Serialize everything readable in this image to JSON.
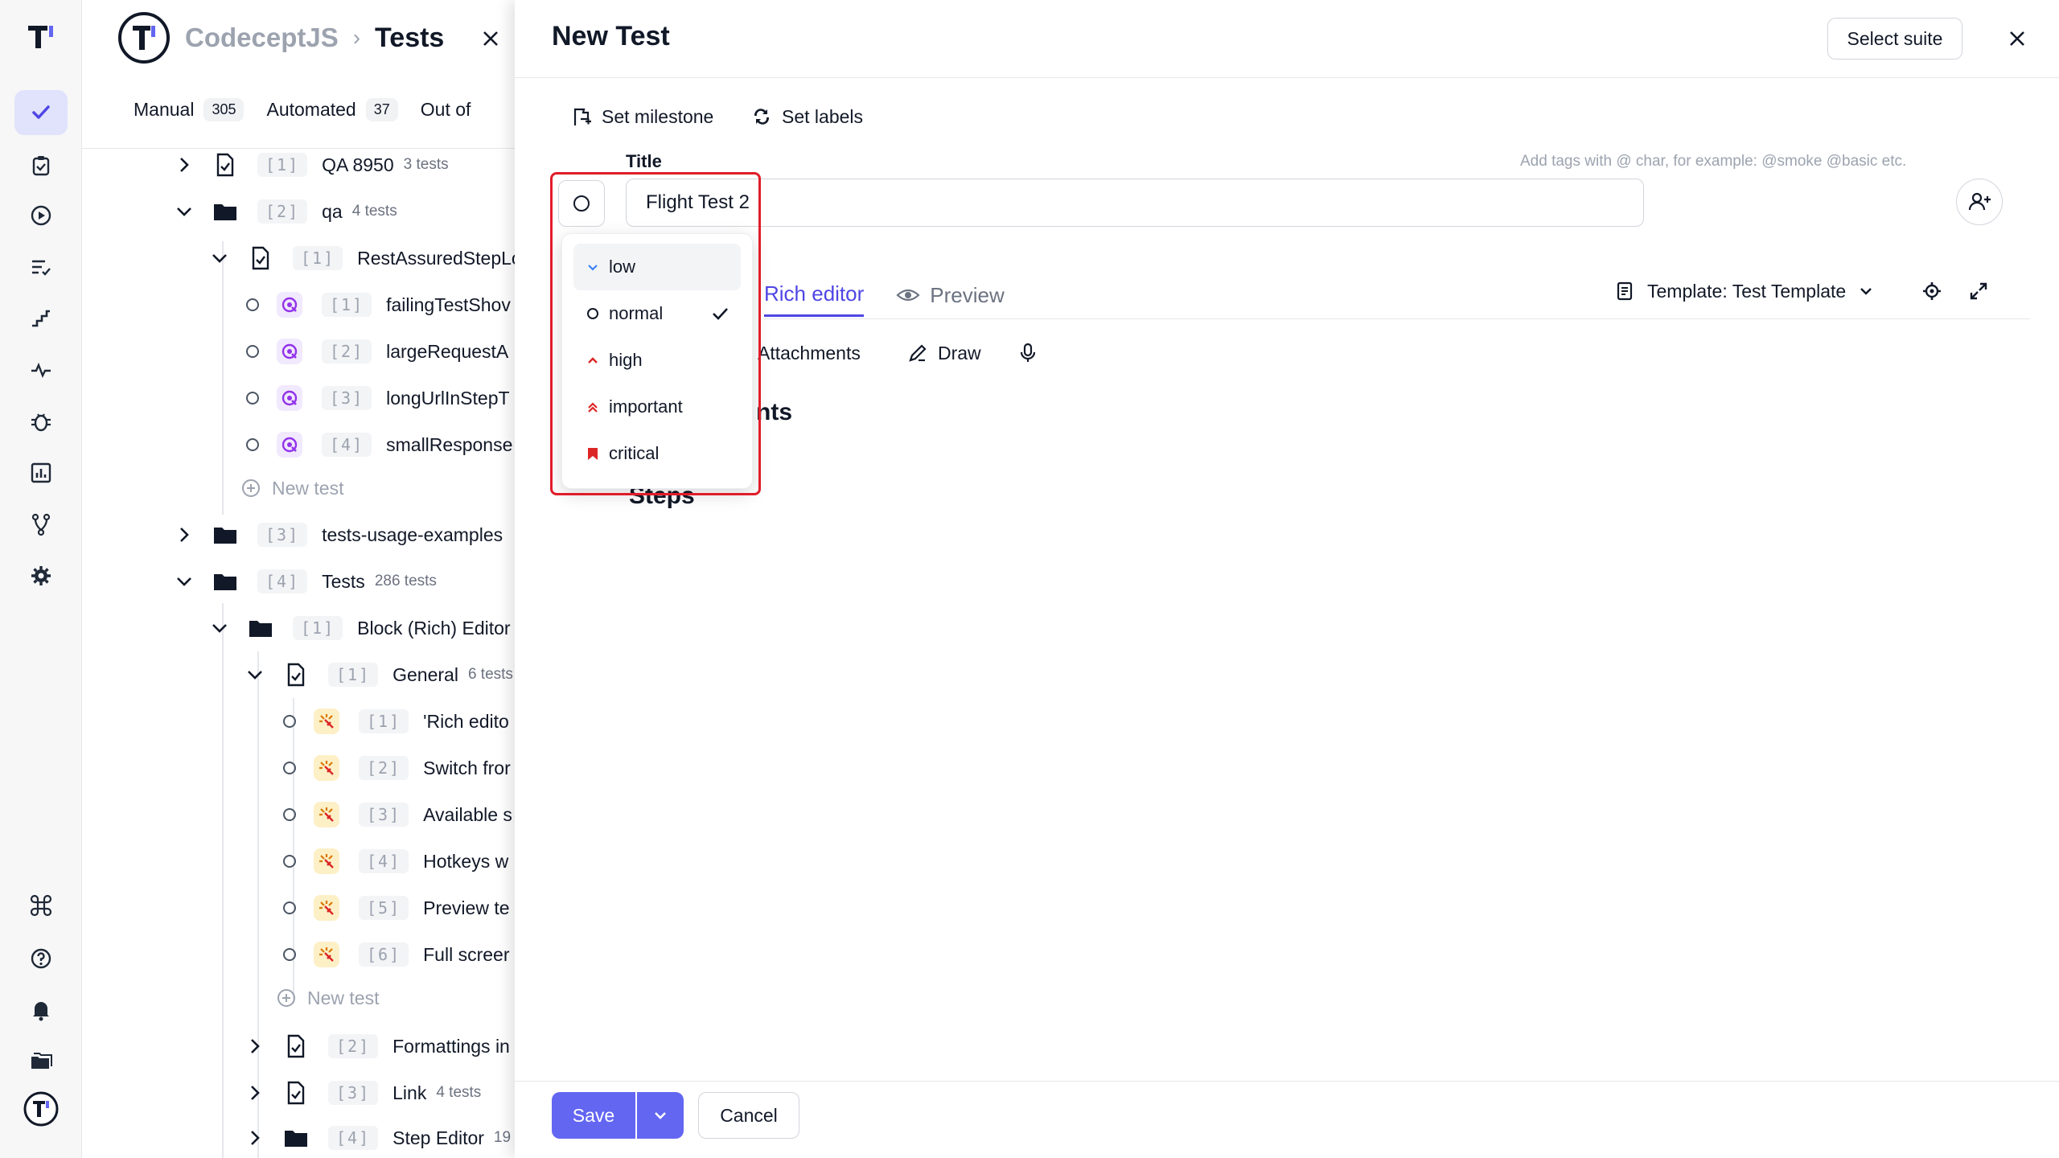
{
  "breadcrumb": {
    "project": "CodeceptJS",
    "separator": "›",
    "page": "Tests"
  },
  "tabs": [
    {
      "label": "Manual",
      "count": "305"
    },
    {
      "label": "Automated",
      "count": "37"
    },
    {
      "label": "Out of",
      "count": ""
    }
  ],
  "tree": {
    "r1": {
      "num": "[1]",
      "label": "QA 8950",
      "count": "3 tests"
    },
    "r2": {
      "num": "[2]",
      "label": "qa",
      "count": "4 tests"
    },
    "r3": {
      "num": "[1]",
      "label": "RestAssuredStepLo"
    },
    "r4": {
      "num": "[1]",
      "label": "failingTestShov"
    },
    "r5": {
      "num": "[2]",
      "label": "largeRequestA"
    },
    "r6": {
      "num": "[3]",
      "label": "longUrlInStepT"
    },
    "r7": {
      "num": "[4]",
      "label": "smallResponse"
    },
    "r8": {
      "label": "New test"
    },
    "r9": {
      "num": "[3]",
      "label": "tests-usage-examples"
    },
    "r10": {
      "num": "[4]",
      "label": "Tests",
      "count": "286 tests"
    },
    "r11": {
      "num": "[1]",
      "label": "Block (Rich) Editor"
    },
    "r12": {
      "num": "[1]",
      "label": "General",
      "count": "6 tests"
    },
    "r13": {
      "num": "[1]",
      "label": "'Rich edito"
    },
    "r14": {
      "num": "[2]",
      "label": "Switch fror"
    },
    "r15": {
      "num": "[3]",
      "label": "Available s"
    },
    "r16": {
      "num": "[4]",
      "label": "Hotkeys w"
    },
    "r17": {
      "num": "[5]",
      "label": "Preview te"
    },
    "r18": {
      "num": "[6]",
      "label": "Full screer"
    },
    "r19": {
      "label": "New test"
    },
    "r20": {
      "num": "[2]",
      "label": "Formattings in"
    },
    "r21": {
      "num": "[3]",
      "label": "Link",
      "count": "4 tests"
    },
    "r22": {
      "num": "[4]",
      "label": "Step Editor",
      "count": "19"
    }
  },
  "drawer": {
    "title": "New Test",
    "select_suite": "Select suite",
    "set_milestone": "Set milestone",
    "set_labels": "Set labels",
    "title_label": "Title",
    "tags_hint": "Add tags with @ char, for example: @smoke @basic etc.",
    "title_value": "Flight Test 2",
    "tab_rich": "Rich editor",
    "tab_preview": "Preview",
    "template": "Template: Test Template",
    "attachments": "Attachments",
    "draw": "Draw",
    "requirements_partial": "nts",
    "steps_partial": "Steps",
    "save": "Save",
    "cancel": "Cancel"
  },
  "priority": {
    "selected": "normal",
    "options": [
      {
        "label": "low",
        "color": "#3b82f6"
      },
      {
        "label": "normal",
        "color": "#111827"
      },
      {
        "label": "high",
        "color": "#dc2626"
      },
      {
        "label": "important",
        "color": "#dc2626"
      },
      {
        "label": "critical",
        "color": "#dc2626"
      }
    ]
  },
  "colors": {
    "accent": "#6366f1",
    "highlight_outline": "#e11d2a",
    "rail_active": "#e0e3fb"
  },
  "icons": [
    "logo-icon",
    "check-icon",
    "clipboard-icon",
    "play-icon",
    "list-check-icon",
    "stairs-icon",
    "pulse-icon",
    "bug-icon",
    "chart-icon",
    "branch-icon",
    "gear-icon",
    "command-icon",
    "help-icon",
    "bell-icon",
    "folders-icon"
  ]
}
